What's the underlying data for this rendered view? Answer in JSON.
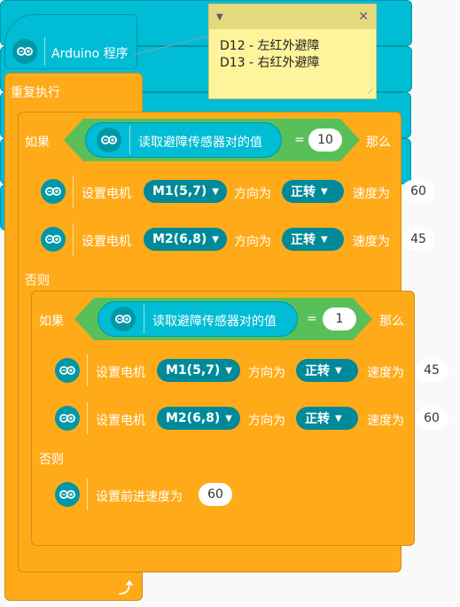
{
  "hat": {
    "label": "Arduino 程序"
  },
  "note": {
    "lines": [
      "D12 - 左红外避障",
      "D13 - 右红外避障"
    ],
    "collapse_icon": "triangle-down-icon",
    "close_icon": "close-icon"
  },
  "forever": {
    "label": "重复执行",
    "loop_icon": "loop-arrow-icon"
  },
  "outer_if": {
    "if_label": "如果",
    "then_label": "那么",
    "else_label": "否则",
    "sensor_label": "读取避障传感器对的值",
    "eq": "=",
    "value": "10",
    "motor1": {
      "prefix": "设置电机",
      "motor": "M1(5,7)",
      "dir_label": "方向为",
      "dir": "正转",
      "speed_label": "速度为",
      "speed": "60"
    },
    "motor2": {
      "prefix": "设置电机",
      "motor": "M2(6,8)",
      "dir_label": "方向为",
      "dir": "正转",
      "speed_label": "速度为",
      "speed": "45"
    }
  },
  "inner_if": {
    "if_label": "如果",
    "then_label": "那么",
    "else_label": "否则",
    "sensor_label": "读取避障传感器对的值",
    "eq": "=",
    "value": "1",
    "motor1": {
      "prefix": "设置电机",
      "motor": "M1(5,7)",
      "dir_label": "方向为",
      "dir": "正转",
      "speed_label": "速度为",
      "speed": "45"
    },
    "motor2": {
      "prefix": "设置电机",
      "motor": "M2(6,8)",
      "dir_label": "方向为",
      "dir": "正转",
      "speed_label": "速度为",
      "speed": "60"
    },
    "forward": {
      "label": "设置前进速度为",
      "speed": "60"
    }
  },
  "colors": {
    "control": "#ffab19",
    "arduino": "#00bcd4",
    "operator": "#59c059",
    "note": "#fef49c"
  }
}
